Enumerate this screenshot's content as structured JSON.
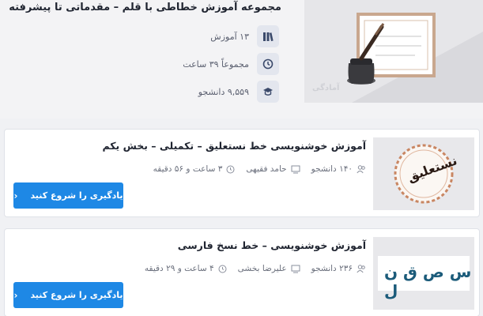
{
  "collection": {
    "title": "مجموعه آموزش خطاطی با قلم – مقدماتی تا پیشرفته",
    "stats": [
      {
        "icon": "books-icon",
        "text": "۱۳ آموزش"
      },
      {
        "icon": "clock-icon",
        "text": "مجموعاً ۳۹ ساعت"
      },
      {
        "icon": "graduation-icon",
        "text": "۹,۵۵۹ دانشجو"
      }
    ],
    "watermark": "آمادگی"
  },
  "courses": [
    {
      "title": "آموزش خوشنویسی خط نستعلیق – تکمیلی – بخش یکم",
      "students": "۱۴۰ دانشجو",
      "teacher": "حامد فقیهی",
      "duration": "۳ ساعت و ۵۶ دقیقه",
      "cta": "یادگیری را شروع کنید",
      "thumb_text": "نستعلیق"
    },
    {
      "title": "آموزش خوشنویسی – خط نسخ فارسی",
      "students": "۲۳۶ دانشجو",
      "teacher": "علیرضا بخشی",
      "duration": "۴ ساعت و ۲۹ دقیقه",
      "cta": "یادگیری را شروع کنید",
      "thumb_text": "س ص ق ن ل"
    }
  ],
  "colors": {
    "accent": "#1e88e5",
    "title": "#1f2430",
    "muted": "#6a6f7c"
  }
}
